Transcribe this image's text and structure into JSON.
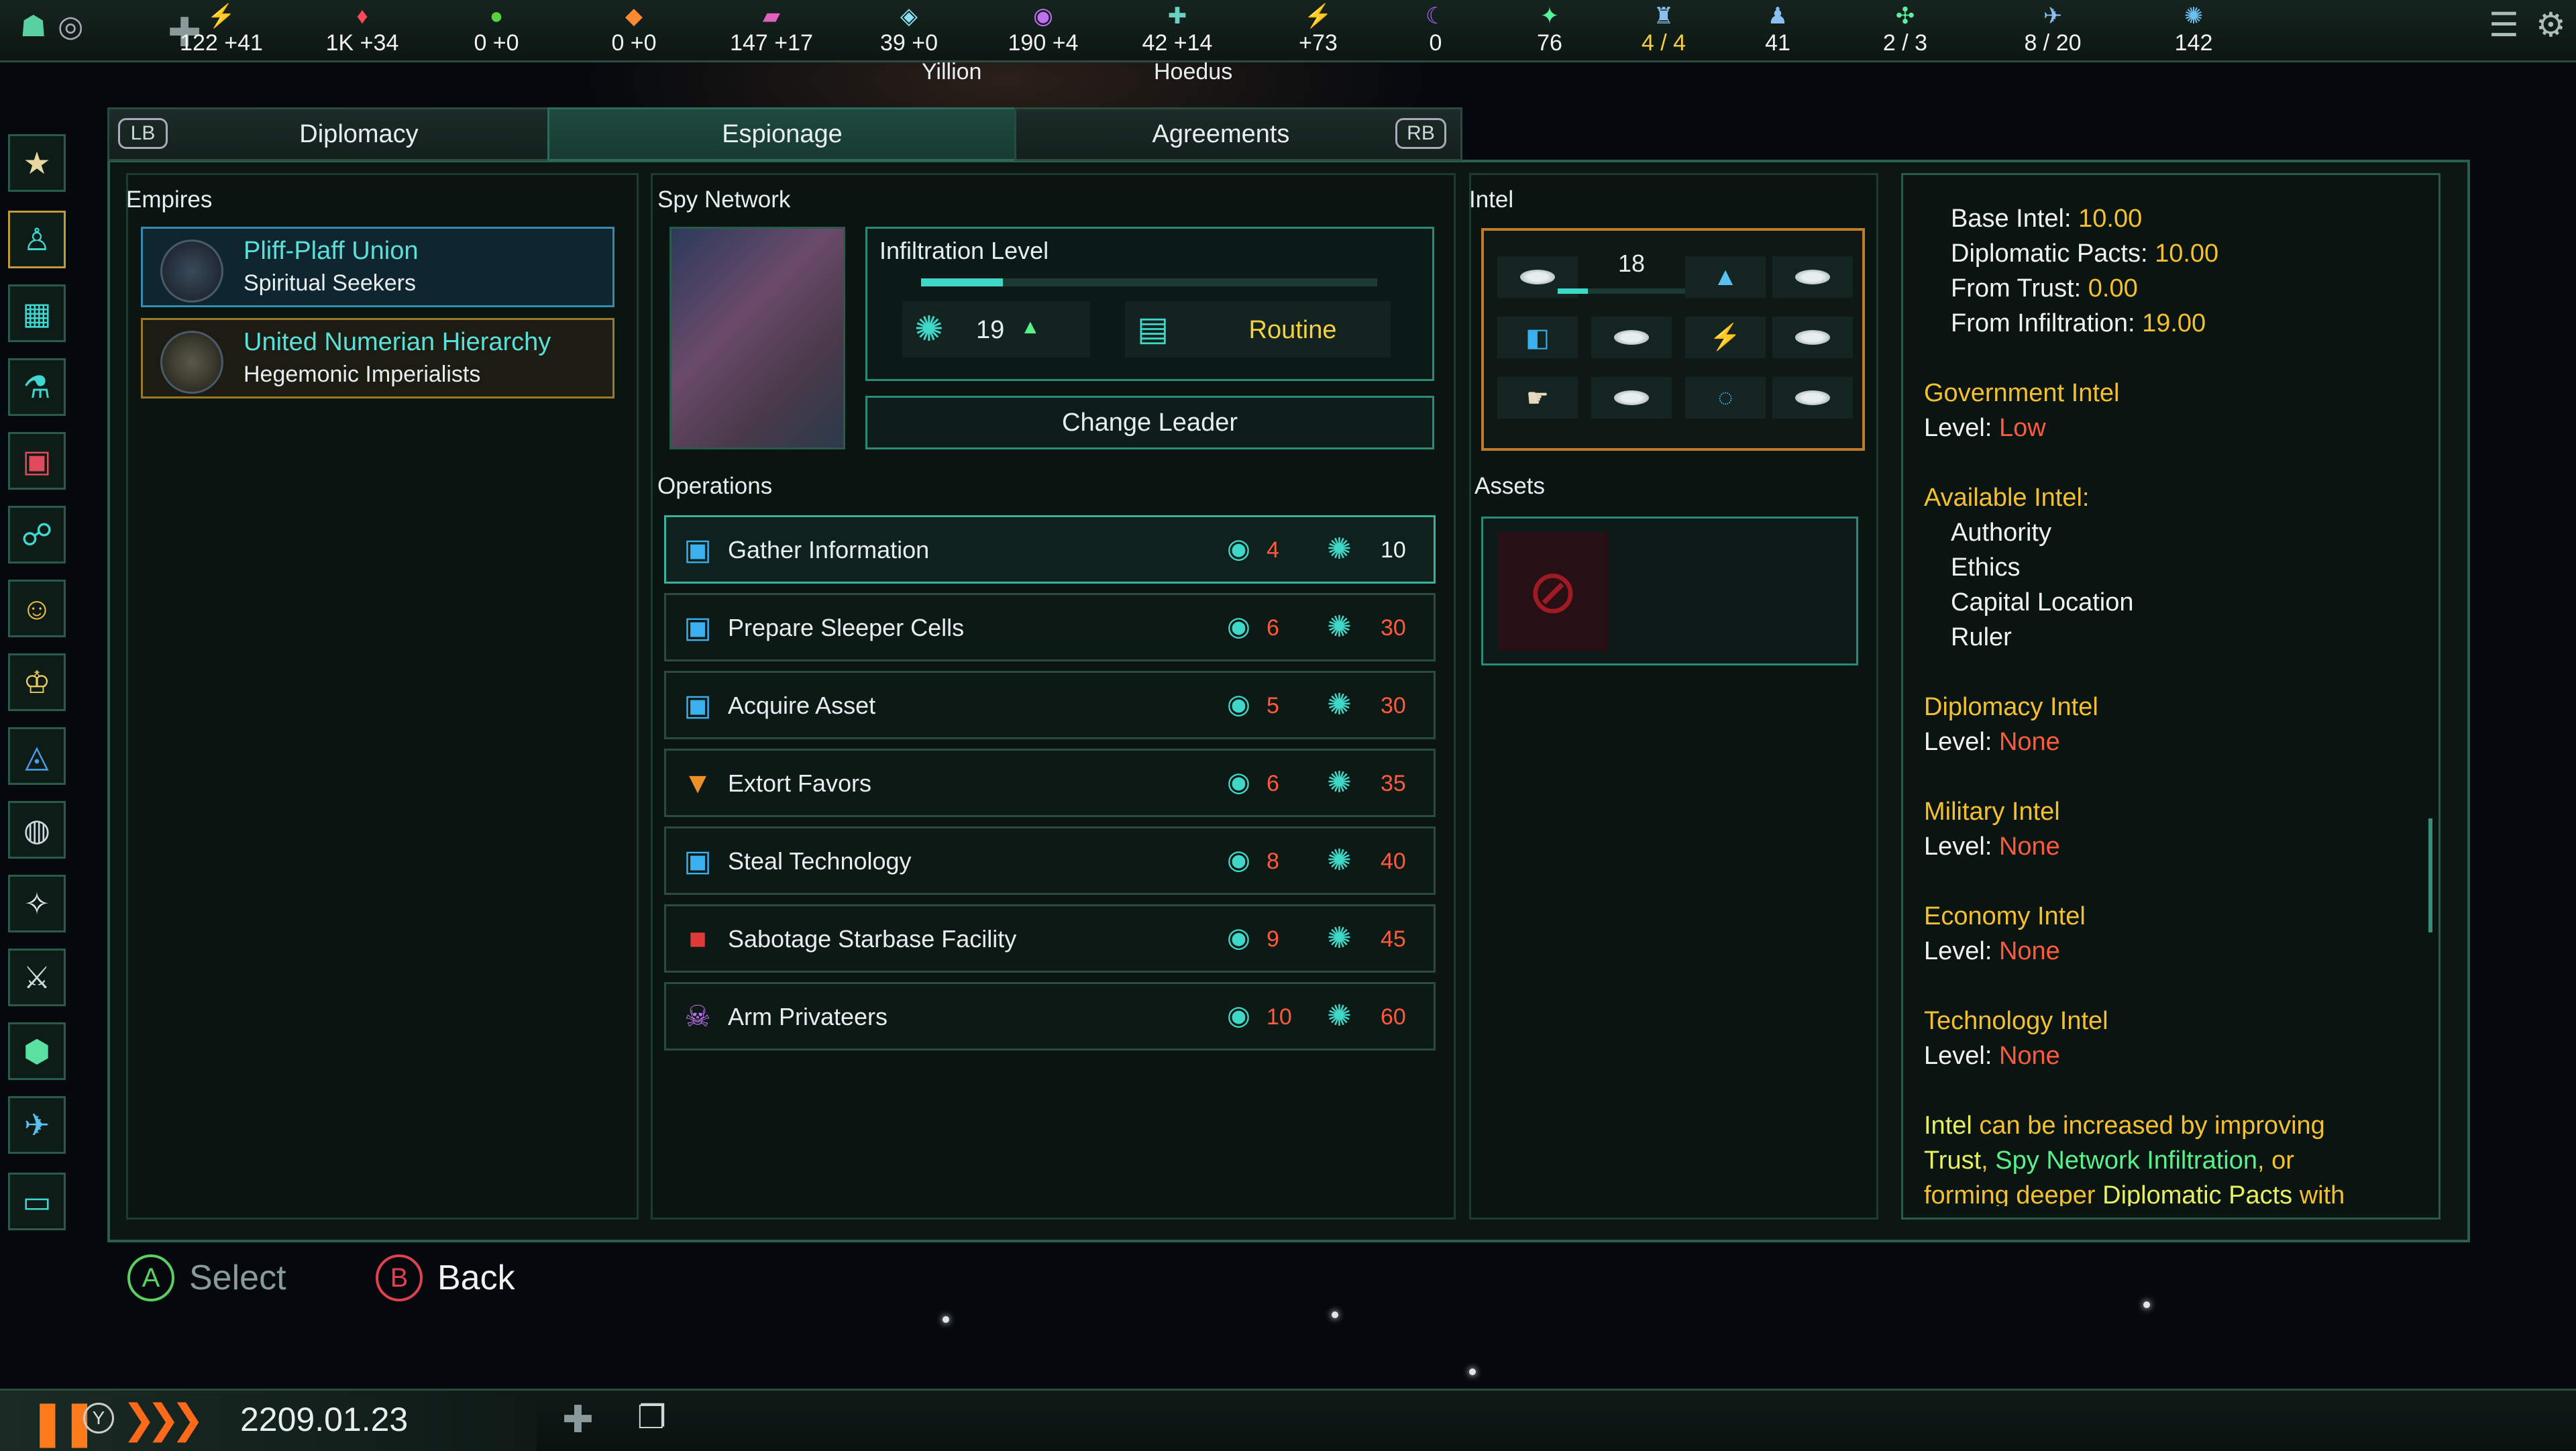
{
  "resources": [
    {
      "icon": "energy-icon",
      "glyph": "⚡",
      "color": "#f5d020",
      "value": "122 +41"
    },
    {
      "icon": "minerals-icon",
      "glyph": "♦",
      "color": "#ff4a5a",
      "value": "1K +34"
    },
    {
      "icon": "food-icon",
      "glyph": "●",
      "color": "#5ad040",
      "value": "0 +0"
    },
    {
      "icon": "consumer-goods-icon",
      "glyph": "◆",
      "color": "#ff8a30",
      "value": "0 +0"
    },
    {
      "icon": "alloys-icon",
      "glyph": "▰",
      "color": "#e060c0",
      "value": "147 +17"
    },
    {
      "icon": "influence-icon",
      "glyph": "◈",
      "color": "#8ae0f0",
      "value": "39 +0"
    },
    {
      "icon": "unity-icon",
      "glyph": "◉",
      "color": "#c070f0",
      "value": "190 +4"
    },
    {
      "icon": "trade-icon",
      "glyph": "✚",
      "color": "#6ad0c0",
      "value": "42 +14"
    },
    {
      "icon": "research-icon",
      "glyph": "⚡",
      "color": "#f0a020",
      "value": "+73"
    },
    {
      "icon": "amenities-icon",
      "glyph": "☾",
      "color": "#a060f0",
      "value": "0"
    },
    {
      "icon": "fleet-icon",
      "glyph": "✦",
      "color": "#5af0a0",
      "value": "76"
    },
    {
      "icon": "envoys-icon",
      "glyph": "♜",
      "color": "#8ac0f0",
      "value": "4 / 4",
      "highlight": true
    },
    {
      "icon": "pops-icon",
      "glyph": "♟",
      "color": "#8ac0f0",
      "value": "41"
    },
    {
      "icon": "starbase-icon",
      "glyph": "✣",
      "color": "#5af0a0",
      "value": "2 / 3"
    },
    {
      "icon": "navy-icon",
      "glyph": "✈",
      "color": "#8ac0f0",
      "value": "8 / 20"
    },
    {
      "icon": "stability-icon",
      "glyph": "✺",
      "color": "#6ac0f0",
      "value": "142"
    }
  ],
  "map_labels": {
    "system1": "Yillion",
    "system2": "Hoedus"
  },
  "tabs": {
    "lb": "LB",
    "diplomacy": "Diplomacy",
    "espionage": "Espionage",
    "agreements": "Agreements",
    "rb": "RB"
  },
  "empires": {
    "title": "Empires",
    "list": [
      {
        "name": "Pliff-Plaff Union",
        "subtitle": "Spiritual Seekers"
      },
      {
        "name": "United Numerian Hierarchy",
        "subtitle": "Hegemonic Imperialists"
      }
    ]
  },
  "spy_network": {
    "title": "Spy Network",
    "infiltration_label": "Infiltration Level",
    "infiltration_value": "19",
    "infiltration_progress": 0.18,
    "mode": "Routine",
    "change_leader": "Change Leader"
  },
  "operations": {
    "title": "Operations",
    "list": [
      {
        "icon": "chip-icon",
        "glyph": "▣",
        "color": "#3ab0f0",
        "name": "Gather Information",
        "cost": "4",
        "difficulty": "10",
        "difficulty_color": "#f2f2f2"
      },
      {
        "icon": "chip-icon",
        "glyph": "▣",
        "color": "#3ab0f0",
        "name": "Prepare Sleeper Cells",
        "cost": "6",
        "difficulty": "30"
      },
      {
        "icon": "chip-icon",
        "glyph": "▣",
        "color": "#3ab0f0",
        "name": "Acquire Asset",
        "cost": "5",
        "difficulty": "30"
      },
      {
        "icon": "fox-icon",
        "glyph": "▼",
        "color": "#f0902a",
        "name": "Extort Favors",
        "cost": "6",
        "difficulty": "35"
      },
      {
        "icon": "chip-icon",
        "glyph": "▣",
        "color": "#3ab0f0",
        "name": "Steal Technology",
        "cost": "8",
        "difficulty": "40"
      },
      {
        "icon": "sabotage-icon",
        "glyph": "■",
        "color": "#e03a3a",
        "name": "Sabotage Starbase Facility",
        "cost": "9",
        "difficulty": "45"
      },
      {
        "icon": "skull-icon",
        "glyph": "☠",
        "color": "#c070f0",
        "name": "Arm Privateers",
        "cost": "10",
        "difficulty": "60"
      }
    ]
  },
  "intel": {
    "title": "Intel",
    "level": "18",
    "level_progress": 0.18
  },
  "assets": {
    "title": "Assets"
  },
  "intel_details": {
    "base_intel_label": "Base Intel: ",
    "base_intel": "10.00",
    "dip_pacts_label": "Diplomatic Pacts: ",
    "dip_pacts": "10.00",
    "trust_label": "From Trust: ",
    "trust": "0.00",
    "infil_label": "From Infiltration: ",
    "infil": "19.00",
    "gov_title": "Government Intel",
    "level_label": "Level: ",
    "gov_level": "Low",
    "available_title": "Available Intel:",
    "available": [
      "Authority",
      "Ethics",
      "Capital Location",
      "Ruler"
    ],
    "diplo_title": "Diplomacy Intel",
    "diplo_level": "None",
    "mil_title": "Military Intel",
    "mil_level": "None",
    "eco_title": "Economy Intel",
    "eco_level": "None",
    "tech_title": "Technology Intel",
    "tech_level": "None",
    "note_intel": "Intel",
    "note_1": " can be increased by improving",
    "note_trust": "Trust",
    "note_comma": ", ",
    "note_spy": "Spy Network Infiltration",
    "note_or": ", or",
    "note_2": "forming deeper ",
    "note_pacts": "Diplomatic Pacts",
    "note_with": " with"
  },
  "hints": {
    "a_key": "A",
    "select": "Select",
    "b_key": "B",
    "back": "Back"
  },
  "bottom": {
    "pause_key": "Y",
    "date": "2209.01.23"
  }
}
